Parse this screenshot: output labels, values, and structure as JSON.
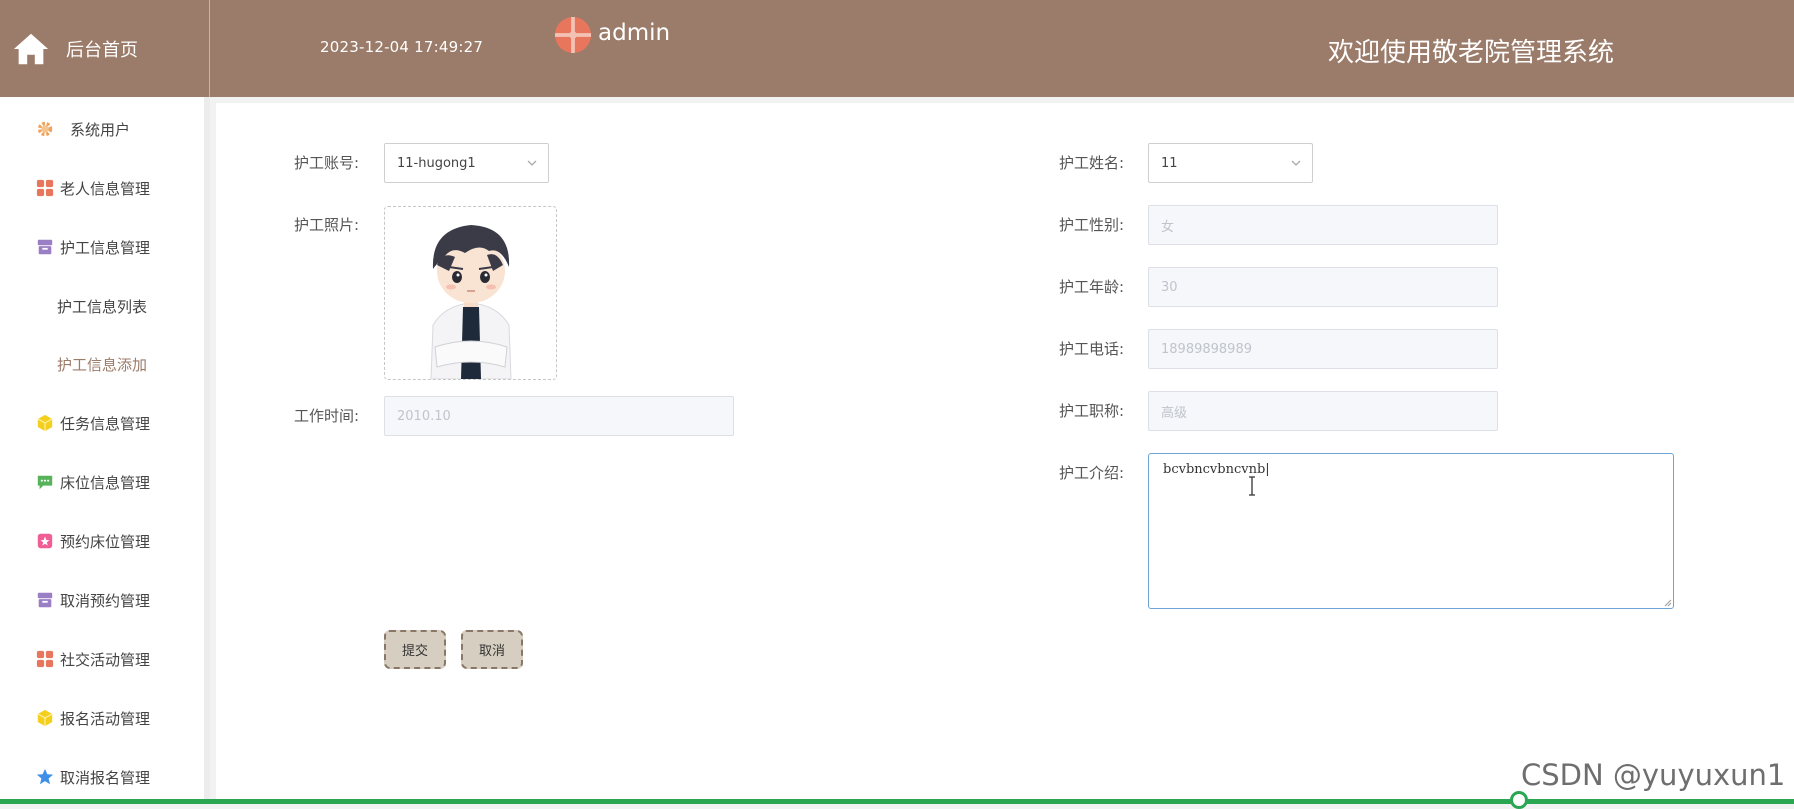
{
  "header": {
    "home_label": "后台首页",
    "clock": "2023-12-04 17:49:27",
    "username": "admin",
    "welcome": "欢迎使用敬老院管理系统"
  },
  "sidebar": {
    "items": [
      {
        "label": "系统用户",
        "icon": "gear-icon",
        "color": "#f0a35a"
      },
      {
        "label": "老人信息管理",
        "icon": "grid-icon",
        "color": "#e8765d"
      },
      {
        "label": "护工信息管理",
        "icon": "archive-icon",
        "color": "#9b7fc4"
      },
      {
        "label": "护工信息列表"
      },
      {
        "label": "护工信息添加"
      },
      {
        "label": "任务信息管理",
        "icon": "cube-icon",
        "color": "#f5cf1e"
      },
      {
        "label": "床位信息管理",
        "icon": "chat-icon",
        "color": "#57b35a"
      },
      {
        "label": "预约床位管理",
        "icon": "badge-icon",
        "color": "#ef5f95"
      },
      {
        "label": "取消预约管理",
        "icon": "archive-icon",
        "color": "#9b7fc4"
      },
      {
        "label": "社交活动管理",
        "icon": "grid-icon",
        "color": "#e8765d"
      },
      {
        "label": "报名活动管理",
        "icon": "cube-icon",
        "color": "#f5cf1e"
      },
      {
        "label": "取消报名管理",
        "icon": "star-icon",
        "color": "#3f8ee8"
      }
    ]
  },
  "form": {
    "account_label": "护工账号:",
    "account_value": "11-hugong1",
    "name_label": "护工姓名:",
    "name_value": "11",
    "photo_label": "护工照片:",
    "gender_label": "护工性别:",
    "gender_value": "女",
    "age_label": "护工年龄:",
    "age_value": "30",
    "phone_label": "护工电话:",
    "phone_value": "18989898989",
    "title_label": "护工职称:",
    "title_value": "高级",
    "worktime_label": "工作时间:",
    "worktime_value": "2010.10",
    "intro_label": "护工介绍:",
    "intro_value": "bcvbncvbncvnb|",
    "submit_label": "提交",
    "cancel_label": "取消"
  },
  "watermark": "CSDN @yuyuxun1",
  "colors": {
    "header_bg": "#9b7b69",
    "active_text": "#9b7b69",
    "progress": "#2aa653"
  }
}
